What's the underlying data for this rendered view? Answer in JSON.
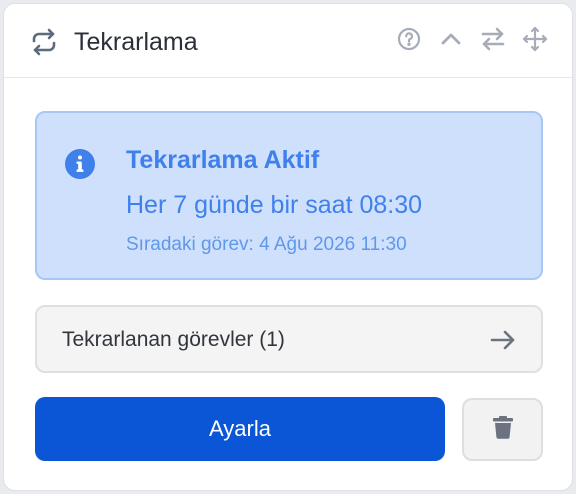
{
  "header": {
    "title": "Tekrarlama",
    "icons": {
      "title": "repeat-icon",
      "help": "question-circle-icon",
      "collapse": "chevron-up-icon",
      "swap": "swap-arrows-icon",
      "move": "move-icon"
    }
  },
  "status": {
    "title": "Tekrarlama Aktif",
    "schedule": "Her 7 günde bir saat 08:30",
    "next_run": "Sıradaki görev: 4 Ağu 2026 11:30",
    "icon": "info-circle-icon"
  },
  "recurring": {
    "label": "Tekrarlanan görevler (1)",
    "icon": "arrow-right-icon"
  },
  "actions": {
    "configure_label": "Ayarla",
    "delete_icon": "trash-icon"
  },
  "colors": {
    "accent": "#0b56d6",
    "info_bg": "#cfe0fd",
    "info_border": "#a9c7f5",
    "info_text": "#3f80ea",
    "icon_gray": "#a6adb8"
  }
}
